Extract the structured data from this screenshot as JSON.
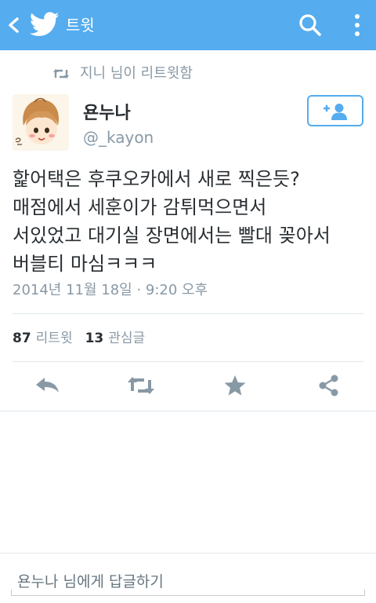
{
  "appbar": {
    "title": "트윗",
    "background_color": "#55acee",
    "icons": [
      "chevron-left-icon",
      "twitter-bird-icon",
      "search-icon",
      "more-vertical-icon"
    ]
  },
  "retweet_context": {
    "icon": "retweet-icon",
    "text": "지니 님이 리트윗함"
  },
  "tweet": {
    "author_name": "욘누나",
    "author_handle": "@_kayon",
    "follow_icon": "add-user-icon",
    "text_lines": [
      "핥어택은 후쿠오카에서 새로 찍은듯?",
      "매점에서 세훈이가 감튀먹으면서",
      "서있었고 대기실 장면에서는 빨대 꽂아서",
      "버블티 마심ㅋㅋㅋ"
    ],
    "timestamp": "2014년 11월 18일 · 9:20 오후"
  },
  "stats": {
    "retweets_count": "87",
    "retweets_label": "리트윗",
    "favorites_count": "13",
    "favorites_label": "관심글"
  },
  "actions": [
    "reply-icon",
    "retweet-icon",
    "star-icon",
    "share-icon"
  ],
  "reply": {
    "placeholder": "욘누나 님에게 답글하기",
    "value": ""
  },
  "colors": {
    "accent": "#55acee",
    "muted_text": "#8899a6",
    "action_icon": "#8899a6"
  }
}
